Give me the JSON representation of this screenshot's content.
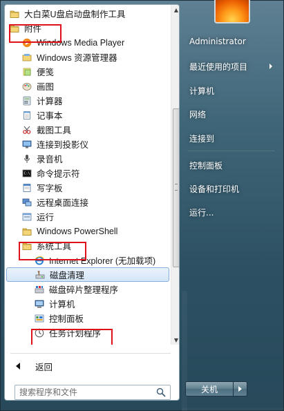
{
  "programs": [
    {
      "label": "大白菜U盘启动盘制作工具",
      "icon": "folder-icon"
    },
    {
      "label": "附件",
      "icon": "folder-icon"
    },
    {
      "label": "Windows Media Player",
      "icon": "media-player-icon"
    },
    {
      "label": "Windows 资源管理器",
      "icon": "explorer-icon"
    },
    {
      "label": "便笺",
      "icon": "sticky-notes-icon"
    },
    {
      "label": "画图",
      "icon": "paint-icon"
    },
    {
      "label": "计算器",
      "icon": "calculator-icon"
    },
    {
      "label": "记事本",
      "icon": "notepad-icon"
    },
    {
      "label": "截图工具",
      "icon": "snipping-tool-icon"
    },
    {
      "label": "连接到投影仪",
      "icon": "projector-icon"
    },
    {
      "label": "录音机",
      "icon": "microphone-icon"
    },
    {
      "label": "命令提示符",
      "icon": "cmd-icon"
    },
    {
      "label": "写字板",
      "icon": "wordpad-icon"
    },
    {
      "label": "远程桌面连接",
      "icon": "remote-desktop-icon"
    },
    {
      "label": "运行",
      "icon": "run-icon"
    },
    {
      "label": "Windows PowerShell",
      "icon": "folder-icon"
    },
    {
      "label": "系统工具",
      "icon": "folder-icon"
    },
    {
      "label": "Internet Explorer (无加载项)",
      "icon": "ie-icon"
    },
    {
      "label": "磁盘清理",
      "icon": "disk-cleanup-icon"
    },
    {
      "label": "磁盘碎片整理程序",
      "icon": "defrag-icon"
    },
    {
      "label": "计算机",
      "icon": "computer-icon"
    },
    {
      "label": "控制面板",
      "icon": "control-panel-icon"
    },
    {
      "label": "任务计划程序",
      "icon": "clock-icon"
    }
  ],
  "back_label": "返回",
  "search": {
    "placeholder": "搜索程序和文件"
  },
  "right_items": [
    {
      "label": "Administrator"
    },
    {
      "label": "最近使用的项目"
    },
    {
      "label": "计算机"
    },
    {
      "label": "网络"
    },
    {
      "label": "连接到"
    },
    {
      "label": "控制面板"
    },
    {
      "label": "设备和打印机"
    },
    {
      "label": "运行..."
    }
  ],
  "shutdown_label": "关机",
  "colors": {
    "highlight_box": "#e0101a",
    "selected_bg": "#d5e6f7",
    "glass": "#3f6678"
  }
}
